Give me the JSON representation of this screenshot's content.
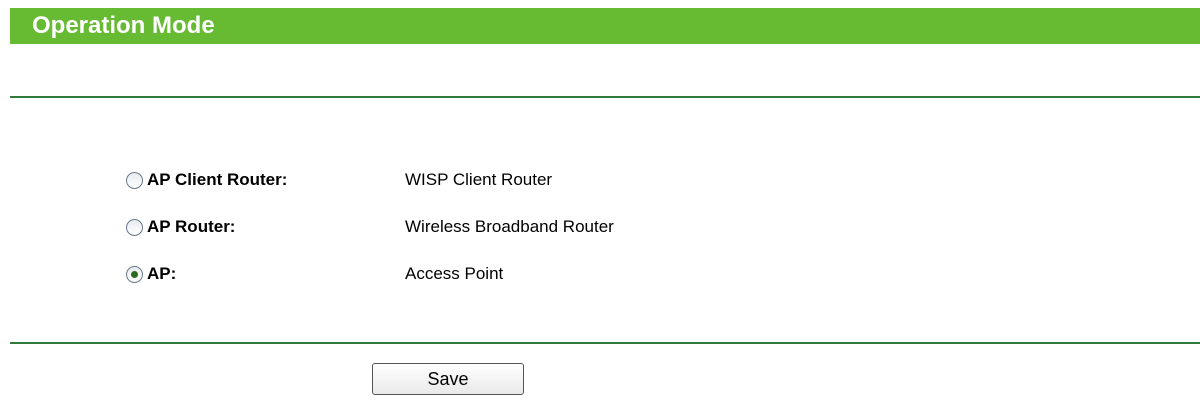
{
  "header": {
    "title": "Operation Mode"
  },
  "modes": [
    {
      "label": "AP Client Router:",
      "description": "WISP Client Router",
      "selected": false
    },
    {
      "label": "AP Router:",
      "description": "Wireless Broadband Router",
      "selected": false
    },
    {
      "label": "AP:",
      "description": "Access Point",
      "selected": true
    }
  ],
  "actions": {
    "save_label": "Save"
  },
  "colors": {
    "header_bg": "#66bb33",
    "rule": "#2f7a3a"
  }
}
